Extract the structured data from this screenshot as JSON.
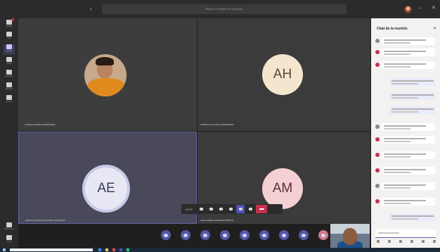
{
  "titlebar": {
    "search_placeholder": "Buscar o escribir un comando",
    "back_icon": "chevron-left-icon"
  },
  "rail": {
    "items": [
      {
        "label": "Actividad",
        "icon": "bell-icon",
        "badge": true
      },
      {
        "label": "Chat",
        "icon": "chat-icon"
      },
      {
        "label": "Equipos",
        "icon": "teams-icon",
        "active": true
      },
      {
        "label": "Tareas",
        "icon": "tasks-icon"
      },
      {
        "label": "Calendario",
        "icon": "calendar-icon"
      },
      {
        "label": "Llamadas",
        "icon": "phone-icon"
      },
      {
        "label": "Archivos",
        "icon": "files-icon"
      },
      {
        "label": "...",
        "icon": "more-icon"
      }
    ],
    "bottom": [
      {
        "label": "Aplicaciones",
        "icon": "apps-icon"
      },
      {
        "label": "Ayuda",
        "icon": "help-icon"
      }
    ]
  },
  "participants": [
    {
      "initials": "",
      "name": "JORGE ALVAREZ FERNANDEZ",
      "has_photo": true
    },
    {
      "initials": "AH",
      "name": "ANDREA HOLGADO FERNANDEZ"
    },
    {
      "initials": "AE",
      "name": "ADRIAN ALONSO ESCOBAR GONZALEZ"
    },
    {
      "initials": "AM",
      "name": "ALBA MARIA GONZALEZ MARTIN"
    }
  ],
  "controls": {
    "timer": "00:57",
    "items": [
      "camera-icon",
      "mic-icon",
      "share-icon",
      "more-icon",
      "chat-icon",
      "participants-icon"
    ],
    "hangup_icon": "hang-up-icon"
  },
  "chat": {
    "title": "Chat de la reunión",
    "close_icon": "close-icon",
    "input_placeholder": "Escribe un mensaje"
  },
  "colors": {
    "accent": "#6264a7",
    "hangup": "#c4314b",
    "background": "#1f1f1f",
    "chat_panel": "#f3f2f1"
  }
}
